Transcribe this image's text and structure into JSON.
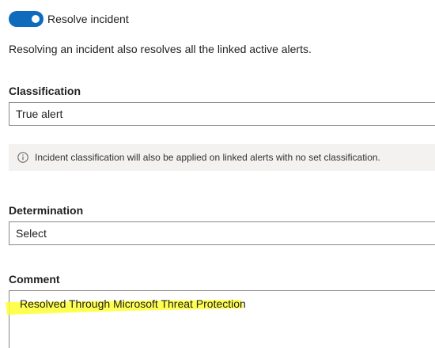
{
  "resolve": {
    "toggle_label": "Resolve incident",
    "toggle_on": true,
    "description": "Resolving an incident also resolves all the linked active alerts."
  },
  "classification": {
    "label": "Classification",
    "value": "True alert"
  },
  "info": {
    "icon": "info-icon",
    "text": "Incident classification will also be applied on linked alerts with no set classification."
  },
  "determination": {
    "label": "Determination",
    "value": "Select"
  },
  "comment": {
    "label": "Comment",
    "value": "Resolved Through Microsoft Threat Protection"
  },
  "colors": {
    "accent": "#0f6cbd",
    "highlight": "#ffff33",
    "info_bg": "#f3f2f1",
    "border": "#8a8886"
  }
}
